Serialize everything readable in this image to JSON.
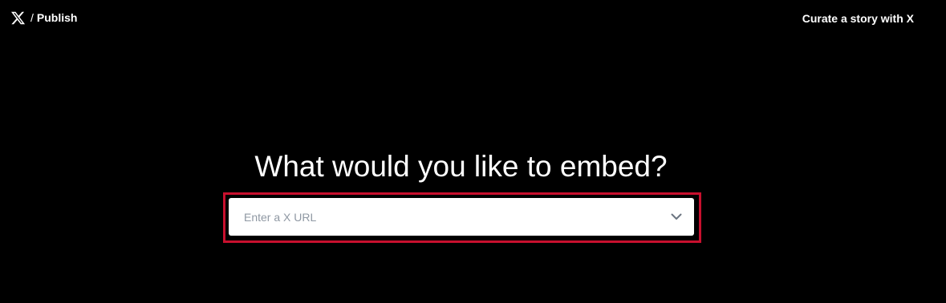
{
  "header": {
    "logo_icon": "x-logo-icon",
    "separator": "/",
    "publish_label": "Publish",
    "curate_link_label": "Curate a story with X"
  },
  "main": {
    "heading": "What would you like to embed?",
    "url_input": {
      "placeholder": "Enter a X URL",
      "value": ""
    },
    "dropdown_icon": "chevron-down-icon"
  },
  "colors": {
    "background": "#000000",
    "text": "#ffffff",
    "highlight_outline": "#c8102e",
    "input_background": "#ffffff",
    "placeholder": "#8f98a3",
    "chevron": "#6b7480"
  }
}
